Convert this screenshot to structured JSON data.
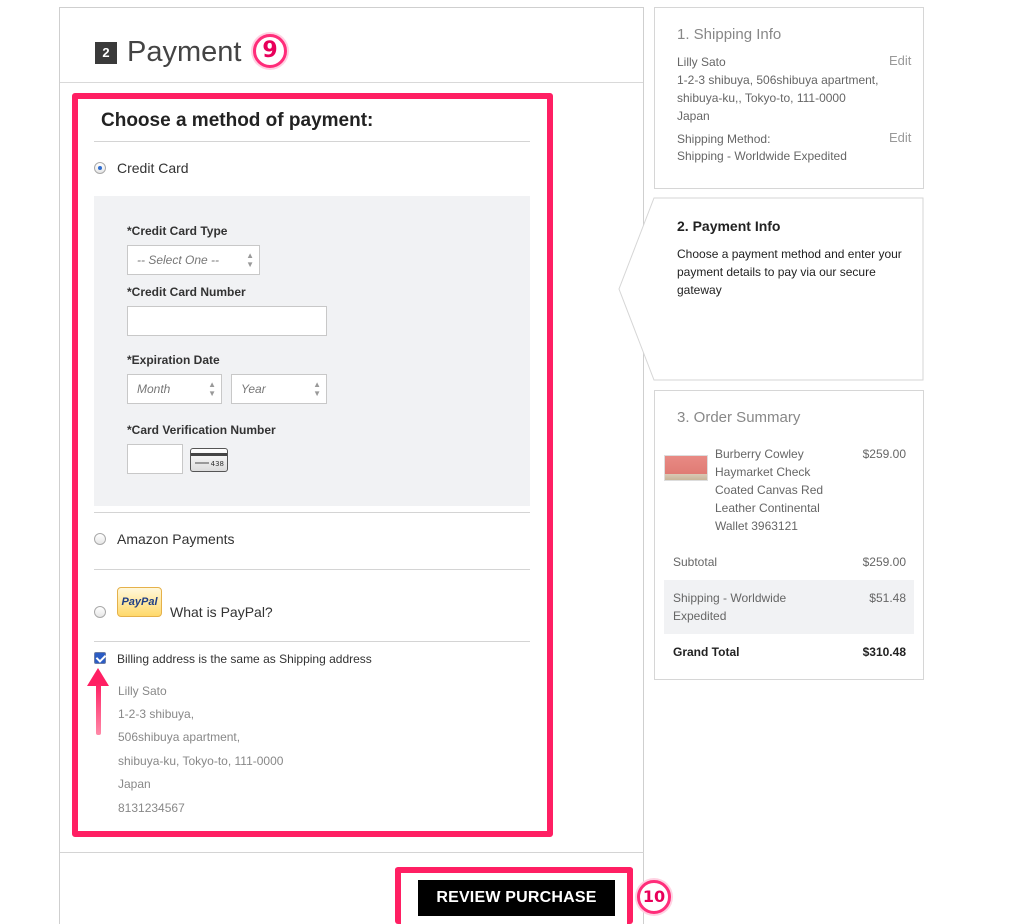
{
  "header": {
    "step_number": "2",
    "title": "Payment",
    "badge": "9"
  },
  "payment": {
    "heading": "Choose a method of payment:",
    "credit_card_label": "Credit Card",
    "card_type_label": "*Credit Card Type",
    "card_type_value": "-- Select One --",
    "card_number_label": "*Credit Card Number",
    "expiration_label": "*Expiration Date",
    "month_value": "Month",
    "year_value": "Year",
    "cvv_label": "*Card Verification Number",
    "cvv_card_number": "438",
    "amazon_label": "Amazon Payments",
    "paypal_logo": "PayPal",
    "paypal_label": "What is PayPal?",
    "selected_method": "Credit Card",
    "billing_same": true,
    "billing_label": "Billing address is the same as Shipping address",
    "billing_address": [
      "Lilly Sato",
      "1-2-3 shibuya,",
      "506shibuya apartment,",
      "shibuya-ku, Tokyo-to, 111-0000",
      "Japan",
      "8131234567"
    ]
  },
  "actions": {
    "review_label": "REVIEW PURCHASE",
    "badge": "10"
  },
  "sidebar": {
    "shipping": {
      "title": "1. Shipping Info",
      "edit_label": "Edit",
      "address": [
        "Lilly Sato",
        "1-2-3 shibuya, 506shibuya apartment,",
        "shibuya-ku,, Tokyo-to,  111-0000",
        "Japan"
      ],
      "method_label": "Shipping Method:",
      "method_value": "Shipping - Worldwide Expedited",
      "method_edit_label": "Edit"
    },
    "payment": {
      "title": "2. Payment Info",
      "description": [
        "Choose a payment method and enter your",
        "payment details to pay via our secure",
        "gateway"
      ]
    },
    "summary": {
      "title": "3. Order Summary",
      "item_name": [
        "Burberry Cowley",
        "Haymarket Check",
        "Coated Canvas Red",
        "Leather Continental",
        "Wallet 3963121"
      ],
      "item_price": "$259.00",
      "subtotal_label": "Subtotal",
      "subtotal_value": "$259.00",
      "shipping_label": [
        "Shipping - Worldwide",
        "Expedited"
      ],
      "shipping_value": "$51.48",
      "total_label": "Grand Total",
      "total_value": "$310.48"
    }
  },
  "colors": {
    "highlight": "#ff1f63",
    "button": "#000000",
    "accent": "#2b5cc4"
  }
}
